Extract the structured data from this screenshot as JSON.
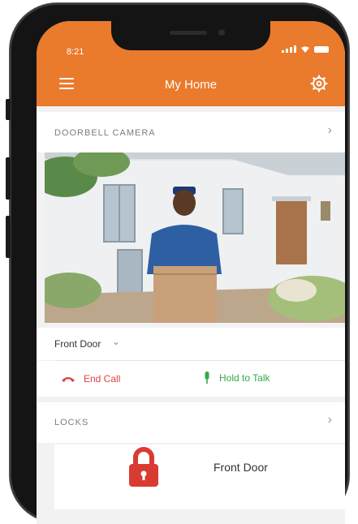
{
  "status_bar": {
    "time": "8:21"
  },
  "header": {
    "title": "My Home",
    "menu_icon": "hamburger-menu-icon",
    "settings_icon": "gear-icon"
  },
  "doorbell": {
    "section_label": "DOORBELL CAMERA",
    "location": "Front Door",
    "end_call_label": "End Call",
    "hold_to_talk_label": "Hold to Talk"
  },
  "locks": {
    "section_label": "LOCKS",
    "item_name": "Front Door"
  },
  "colors": {
    "brand_orange": "#ea7a2c",
    "end_call_red": "#e0413b",
    "talk_green": "#36a84a",
    "lock_red": "#d93b32"
  }
}
